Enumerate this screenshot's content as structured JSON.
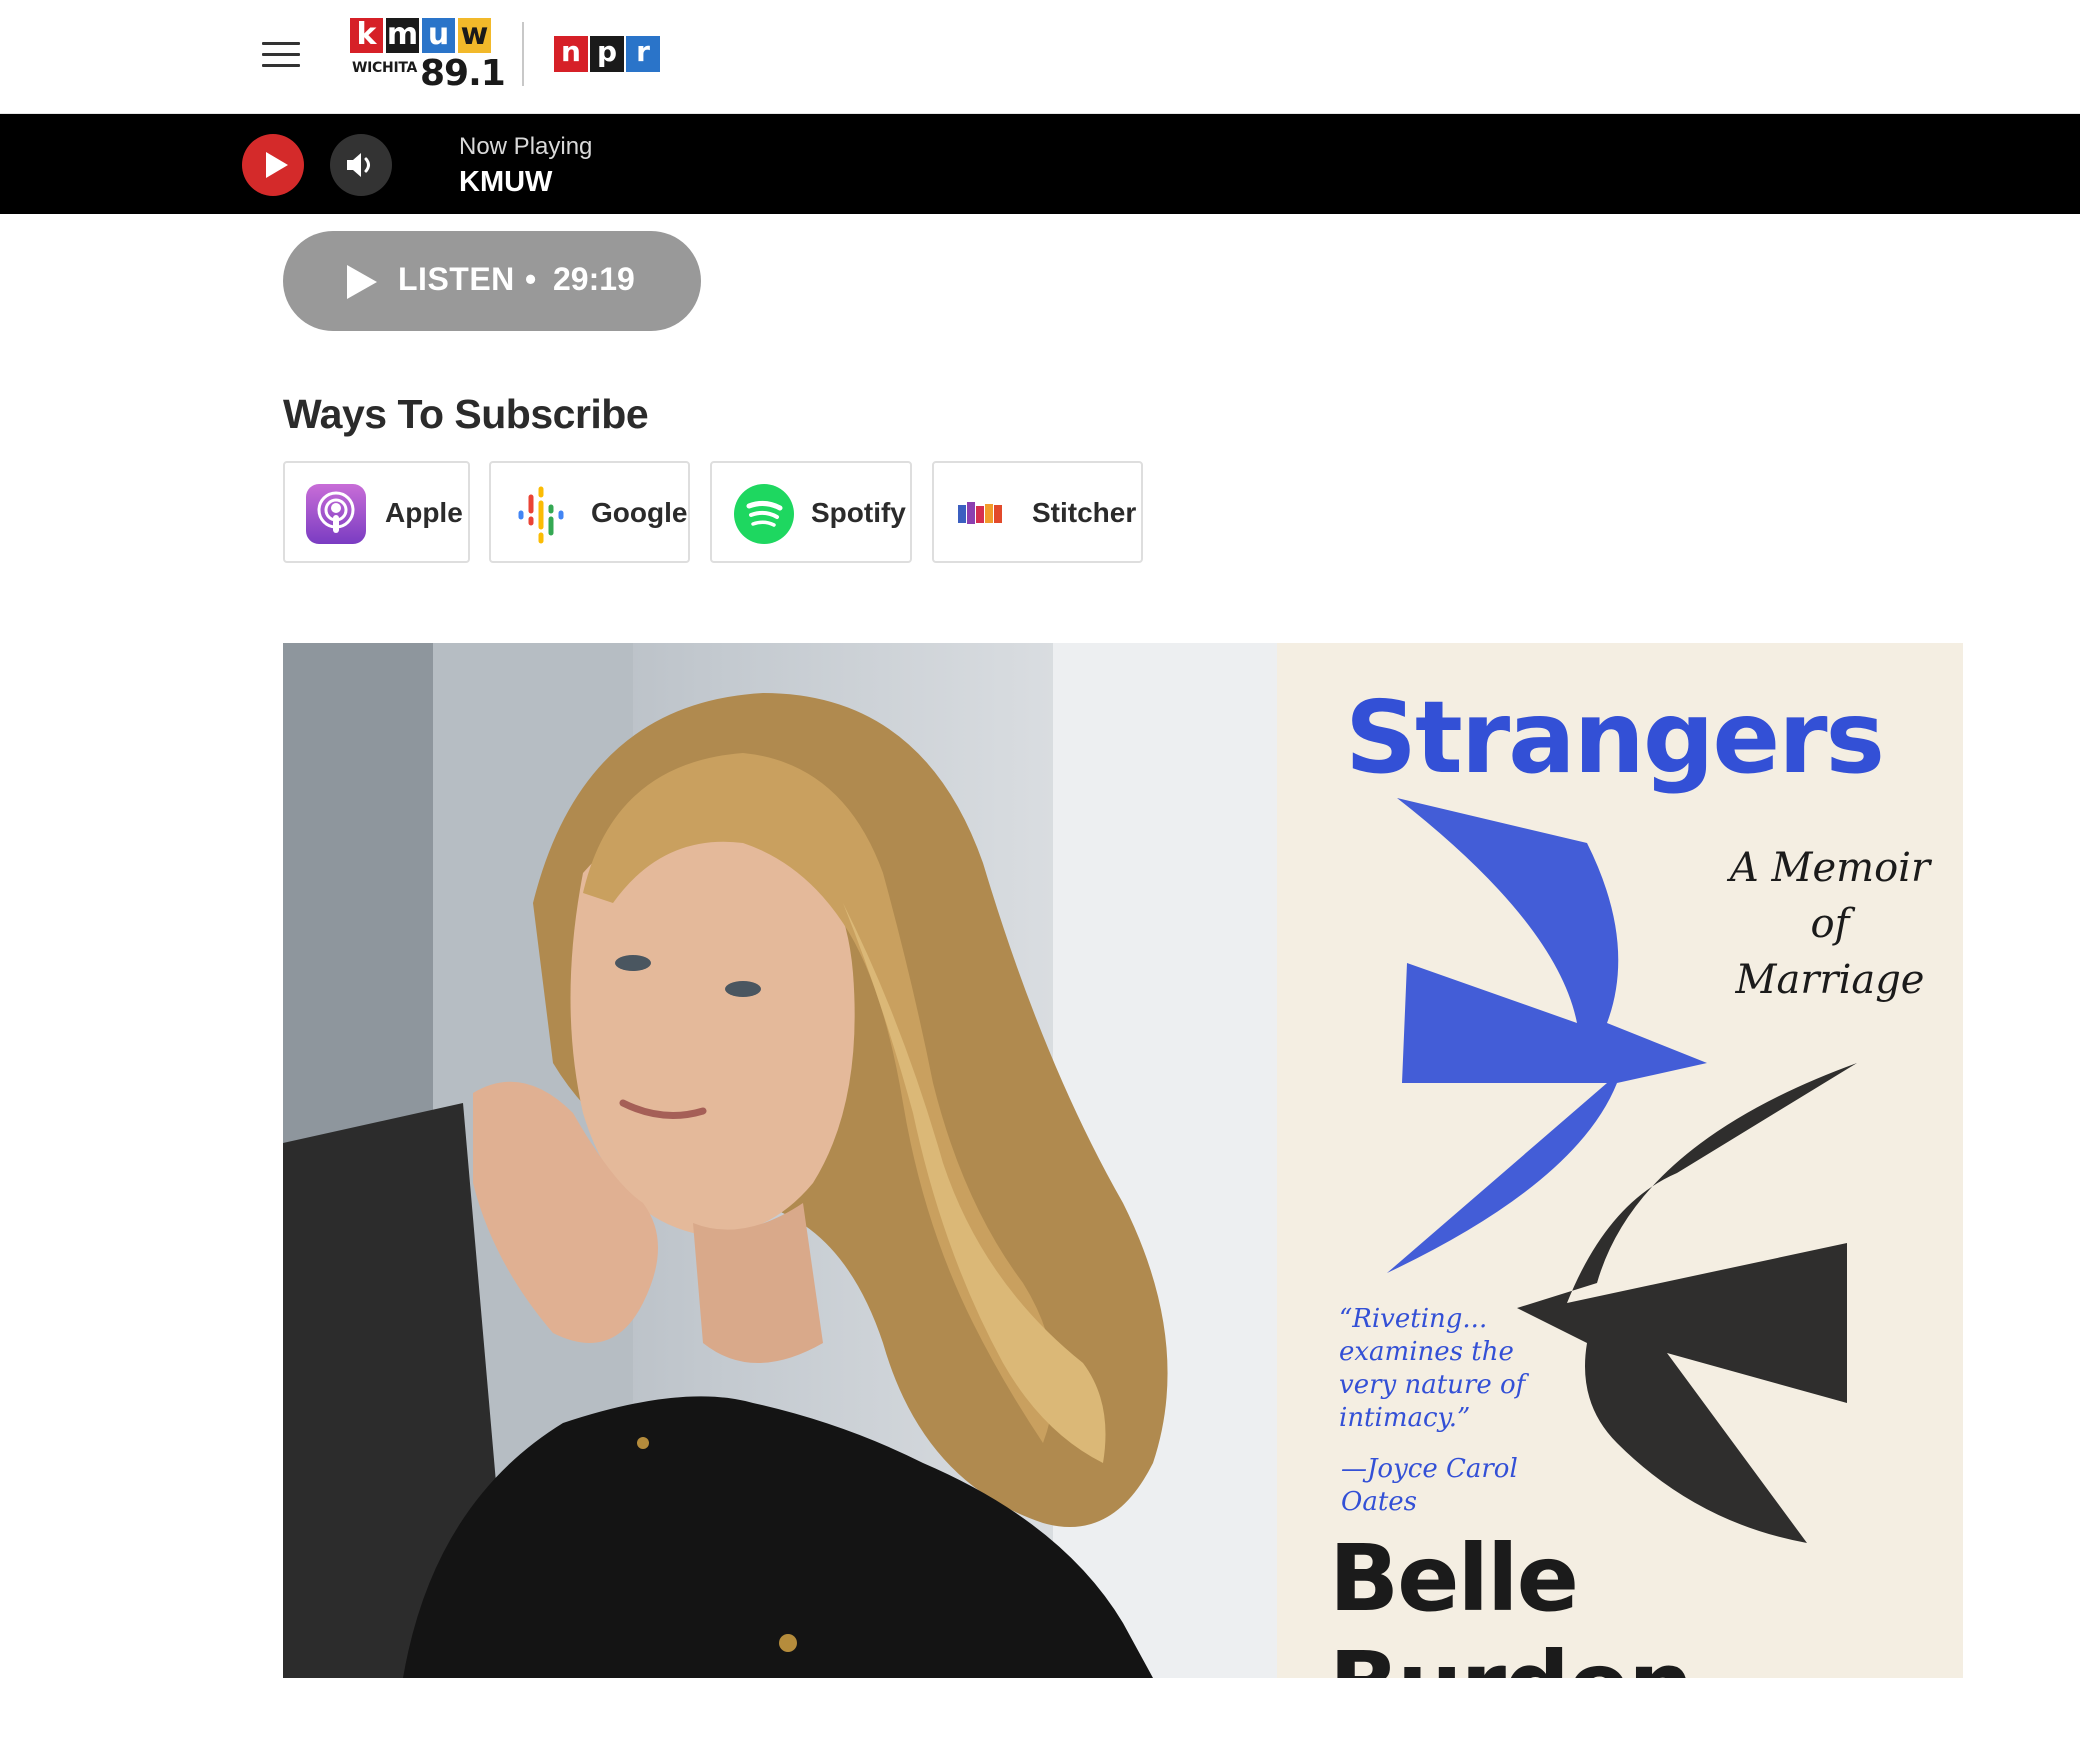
{
  "header": {
    "menu_icon": "hamburger-menu-icon",
    "station_logo": {
      "letters": [
        "k",
        "m",
        "u",
        "w"
      ],
      "city": "WICHITA",
      "frequency": "89.1",
      "colors": [
        "#d62027",
        "#1a1a1a",
        "#2a74c9",
        "#f2b92a"
      ]
    },
    "npr_logo": {
      "letters": [
        "n",
        "p",
        "r"
      ],
      "colors": [
        "#d62027",
        "#1a1a1a",
        "#2a74c9"
      ]
    }
  },
  "player": {
    "play_icon": "play-icon",
    "volume_icon": "volume-icon",
    "now_playing_label": "Now Playing",
    "station": "KMUW",
    "accent_color": "#d42a2a"
  },
  "listen": {
    "icon": "play-icon",
    "label": "LISTEN",
    "separator": "•",
    "duration": "29:19"
  },
  "subscribe": {
    "title": "Ways To Subscribe",
    "options": [
      {
        "label": "Apple",
        "icon": "apple-podcasts-icon"
      },
      {
        "label": "Google",
        "icon": "google-podcasts-icon"
      },
      {
        "label": "Spotify",
        "icon": "spotify-icon"
      },
      {
        "label": "Stitcher",
        "icon": "stitcher-icon"
      }
    ]
  },
  "hero": {
    "book_cover": {
      "title": "Strangers",
      "subtitle": "A Memoir of Marriage",
      "quote": "“Riveting... examines the very nature of intimacy.”",
      "quote_author": "—Joyce Carol Oates",
      "author": "Belle Burden",
      "title_color": "#3350d6"
    }
  }
}
